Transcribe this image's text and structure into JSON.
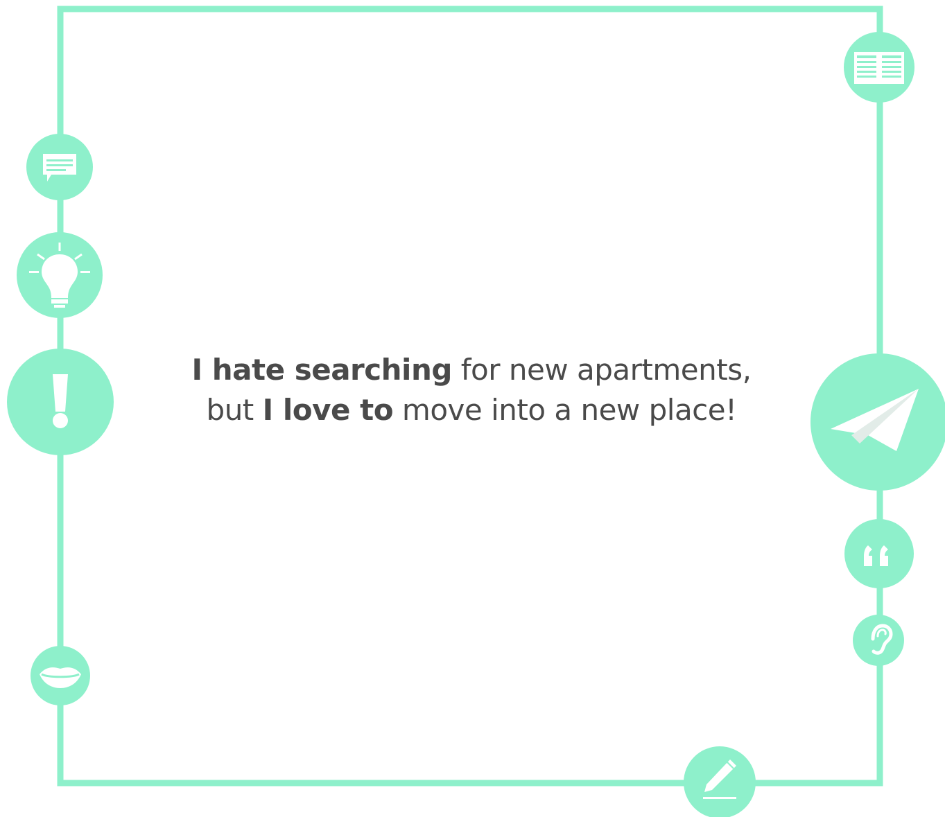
{
  "colors": {
    "accent": "#8ef0cb",
    "icon_fg": "#ffffff",
    "icon_shade": "#e2ece8",
    "text": "#4a4a4a",
    "background": "#ffffff"
  },
  "quote": {
    "line1_bold": "I hate searching",
    "line1_rest": " for new apartments,",
    "line2_pre": "but ",
    "line2_bold": "I love to",
    "line2_rest": " move into a new place!"
  },
  "icons": [
    "chat-bubble-icon",
    "lightbulb-icon",
    "exclamation-icon",
    "lips-icon",
    "newspaper-icon",
    "paper-plane-icon",
    "quote-mark-icon",
    "ear-icon",
    "pencil-icon"
  ]
}
